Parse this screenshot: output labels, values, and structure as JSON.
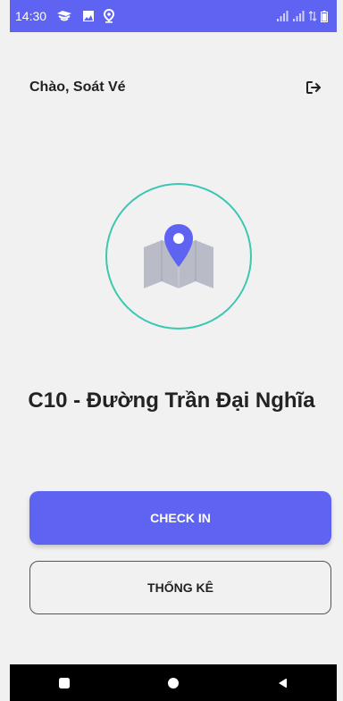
{
  "status_bar": {
    "time": "14:30"
  },
  "header": {
    "greeting": "Chào, Soát Vé"
  },
  "station": {
    "name": "C10 - Đường Trần Đại Nghĩa"
  },
  "buttons": {
    "check_in": "CHECK IN",
    "stats": "THỐNG KÊ"
  },
  "icons": {
    "status": [
      "cloud-sync-icon",
      "image-icon",
      "location-icon",
      "signal-icon",
      "signal-icon",
      "data-icon",
      "battery-icon"
    ],
    "logout": "logout-icon",
    "map": "map-pin-icon",
    "nav": [
      "square-icon",
      "circle-icon",
      "back-triangle-icon"
    ]
  },
  "colors": {
    "primary": "#5f63f1",
    "circle_border": "#3cc7b0",
    "map_icon": "#b9bcc7",
    "background": "#f1f1f2"
  }
}
